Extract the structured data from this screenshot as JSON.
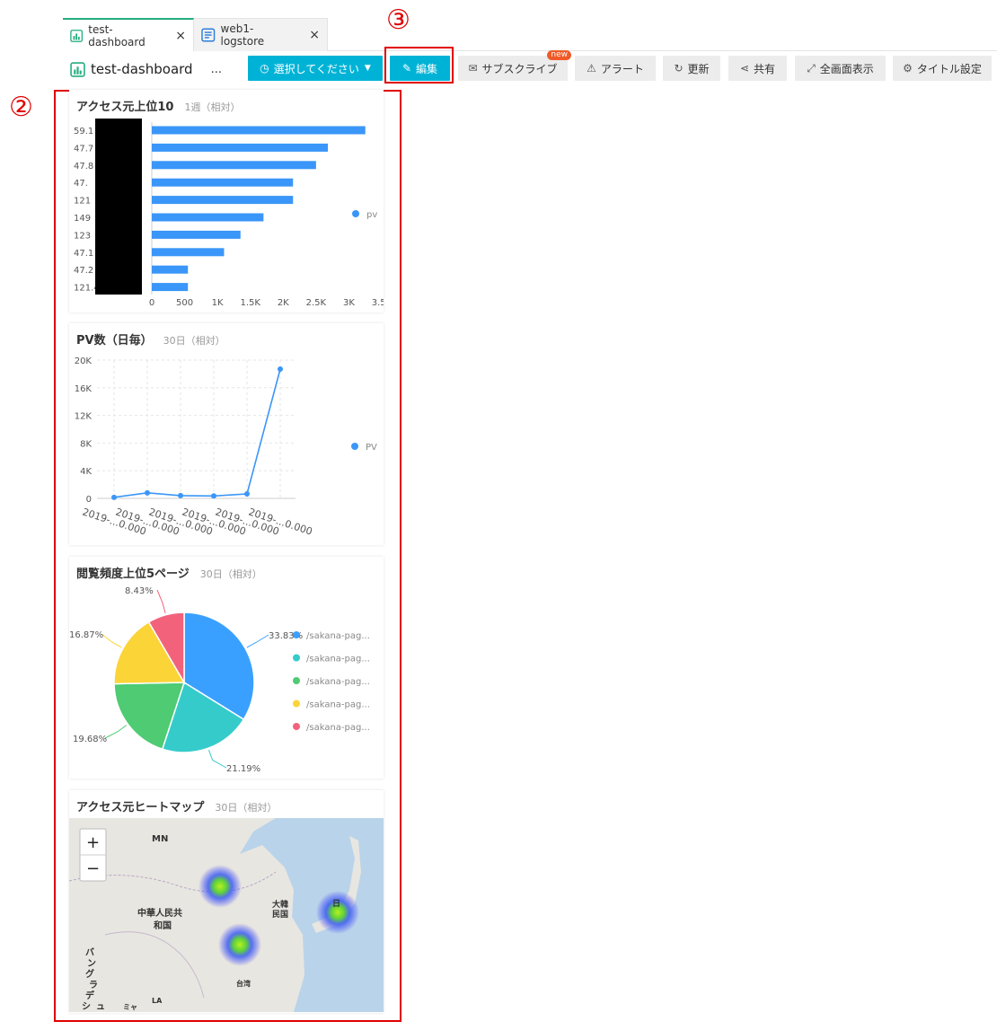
{
  "tabs": [
    {
      "label": "test-dashboard",
      "icon": "dashboard-icon",
      "active": true
    },
    {
      "label": "web1-logstore",
      "icon": "logstore-icon",
      "active": false
    }
  ],
  "toolbar": {
    "title": "test-dashboard",
    "more": "...",
    "time_select": "選択してください",
    "edit": "編集",
    "subscribe": "サブスクライブ",
    "new_badge": "new",
    "alert": "アラート",
    "refresh": "更新",
    "share": "共有",
    "fullscreen": "全画面表示",
    "title_settings": "タイトル設定"
  },
  "annotations": {
    "panel_area": "②",
    "edit_button": "③"
  },
  "colors": {
    "primary": "#00b3d6",
    "series": "#3a96f8",
    "annotation": "#e00000"
  },
  "panels": {
    "top_sources": {
      "title": "アクセス元上位10",
      "range": "1週（相対）",
      "legend": "pv",
      "redacted": true,
      "chart_data": {
        "type": "bar",
        "orientation": "horizontal",
        "categories": [
          "59.1",
          "47.7",
          "47.8",
          "47.",
          "121",
          "149",
          "123",
          "47.1",
          "47.2",
          "121.4"
        ],
        "values": [
          3250,
          2680,
          2500,
          2150,
          2150,
          1700,
          1350,
          1100,
          550,
          550
        ],
        "ticks": [
          "0",
          "500",
          "1K",
          "1.5K",
          "2K",
          "2.5K",
          "3K",
          "3.5K"
        ],
        "xlim": [
          0,
          3500
        ],
        "legend_position": "right"
      }
    },
    "pv_daily": {
      "title": "PV数（日毎）",
      "range": "30日（相対）",
      "legend": "PV",
      "chart_data": {
        "type": "line",
        "x": [
          "2019-...0.000",
          "2019-...0.000",
          "2019-...0.000",
          "2019-...0.000",
          "2019-...0.000",
          "2019-...0.000"
        ],
        "values": [
          150,
          800,
          400,
          350,
          650,
          18700
        ],
        "yticks": [
          "0",
          "4K",
          "8K",
          "12K",
          "16K",
          "20K"
        ],
        "ylim": [
          0,
          20000
        ],
        "grid": true,
        "legend_position": "right"
      }
    },
    "top_pages": {
      "title": "閲覧頻度上位5ページ",
      "range": "30日（相対）",
      "chart_data": {
        "type": "pie",
        "labels": [
          "/sakana-pag...",
          "/sakana-pag...",
          "/sakana-pag...",
          "/sakana-pag...",
          "/sakana-pag..."
        ],
        "values": [
          33.83,
          21.19,
          19.68,
          16.87,
          8.43
        ],
        "value_labels": [
          "33.83%",
          "21.19%",
          "19.68%",
          "16.87%",
          "8.43%"
        ],
        "colors": [
          "#3aa0ff",
          "#36cbcb",
          "#4ecb73",
          "#fbd437",
          "#f2637b"
        ],
        "legend_position": "right"
      }
    },
    "heatmap": {
      "title": "アクセス元ヒートマップ",
      "range": "30日（相対）",
      "zoom_in": "+",
      "zoom_out": "−",
      "labels": [
        "MN",
        "中華人民共",
        "和国",
        "大韓",
        "民国",
        "日",
        "台湾",
        "バ",
        "ン",
        "グ",
        "ラ",
        "デ",
        "シ",
        "ュ",
        "ミャ",
        "LA"
      ]
    }
  }
}
